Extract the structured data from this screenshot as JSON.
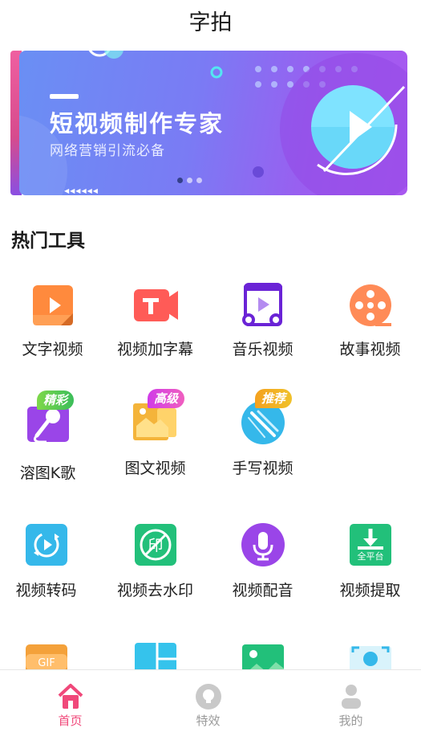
{
  "app": {
    "title": "字拍"
  },
  "banner": {
    "headline": "短视频制作专家",
    "subtitle": "网络营销引流必备",
    "slides_count": 3,
    "active_slide": 0
  },
  "section": {
    "title": "热门工具"
  },
  "tools": [
    {
      "label": "文字视频",
      "icon": "text-video-icon"
    },
    {
      "label": "视频加字幕",
      "icon": "video-subtitle-icon"
    },
    {
      "label": "音乐视频",
      "icon": "music-video-icon"
    },
    {
      "label": "故事视频",
      "icon": "story-video-icon"
    },
    {
      "label": "溶图K歌",
      "icon": "karaoke-icon",
      "badge": "精彩"
    },
    {
      "label": "图文视频",
      "icon": "image-text-video-icon",
      "badge": "高级"
    },
    {
      "label": "手写视频",
      "icon": "handwriting-video-icon",
      "badge": "推荐"
    },
    {
      "label": "视频转码",
      "icon": "video-transcode-icon"
    },
    {
      "label": "视频去水印",
      "icon": "remove-watermark-icon",
      "icon_text": "印"
    },
    {
      "label": "视频配音",
      "icon": "microphone-icon"
    },
    {
      "label": "视频提取",
      "icon": "video-extract-icon",
      "icon_text": "全平台"
    },
    {
      "label": "",
      "icon": "gif-icon",
      "icon_text": "GIF"
    },
    {
      "label": "",
      "icon": "collage-icon"
    },
    {
      "label": "",
      "icon": "image-icon"
    },
    {
      "label": "",
      "icon": "portrait-icon"
    }
  ],
  "nav": {
    "home": "首页",
    "effects": "特效",
    "mine": "我的"
  },
  "colors": {
    "accent": "#f0487a",
    "banner_start": "#6a8ff4",
    "banner_end": "#a957f0"
  }
}
